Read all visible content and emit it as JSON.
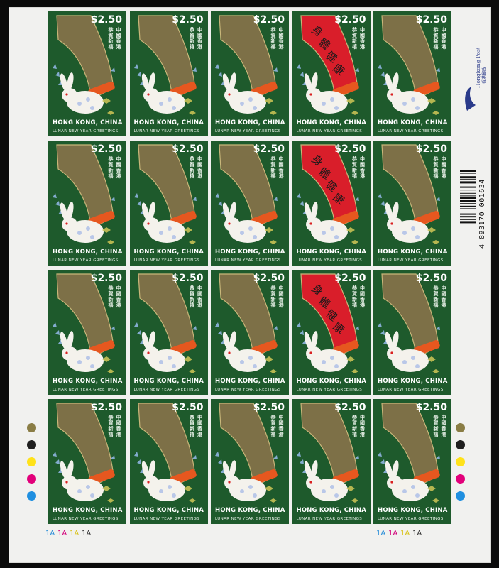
{
  "sheet": {
    "rows": 4,
    "cols": 5,
    "stamp": {
      "value": "$2.50",
      "country": "HONG KONG, CHINA",
      "subtitle": "LUNAR NEW YEAR GREETINGS",
      "vertical_chars": [
        "中",
        "國",
        "香",
        "港"
      ],
      "vertical_chars2": [
        "恭",
        "賀",
        "新",
        "禧"
      ],
      "scroll_chars": [
        "身",
        "體",
        "健",
        "康"
      ]
    },
    "red_scroll_positions": [
      "r1c4",
      "r2c4",
      "r3c4"
    ],
    "barcode": {
      "digits": "4 893170 001634"
    },
    "logo": {
      "text": "Hongkong Post",
      "sub": "香港郵政"
    },
    "traffic_lights": {
      "colors": [
        "#8a7d45",
        "#1f1f1f",
        "#ffe21a",
        "#e2007a",
        "#1f8fe0"
      ]
    },
    "plate_numbers": [
      {
        "label": "1A",
        "color": "#2a8fd8"
      },
      {
        "label": "1A",
        "color": "#d2007a"
      },
      {
        "label": "1A",
        "color": "#d8c21a"
      },
      {
        "label": "1A",
        "color": "#333333"
      }
    ],
    "colors": {
      "stamp_green": "#1e5a2c",
      "scroll_gold": "#7d7047",
      "scroll_red": "#d91e2a",
      "rabbit": "#f4f2ec",
      "roll_orange": "#e6571f"
    }
  }
}
